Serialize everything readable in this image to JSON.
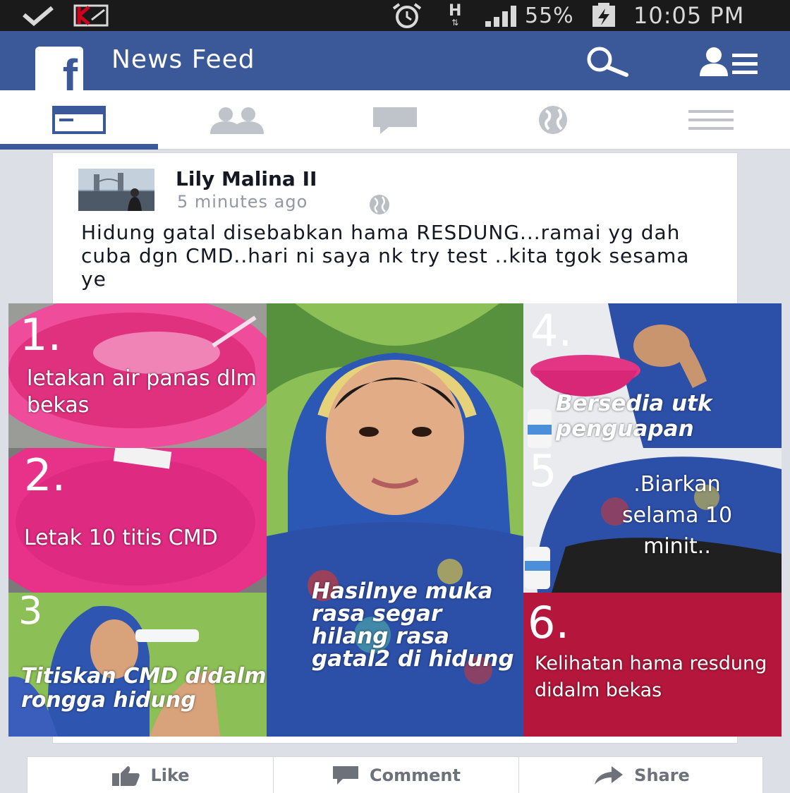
{
  "status_bar": {
    "battery": "55%",
    "time": "10:05 PM",
    "network_type": "H",
    "icons": [
      "check-icon",
      "kaspersky-icon",
      "alarm-icon",
      "network-h-icon",
      "signal-icon",
      "battery-charging-icon"
    ]
  },
  "header": {
    "logo": "f",
    "title": "News Feed",
    "icons": [
      "search-icon",
      "friend-requests-icon"
    ]
  },
  "tabs": [
    {
      "name": "news-feed",
      "icon": "news-feed-icon",
      "active": true
    },
    {
      "name": "friends",
      "icon": "friends-icon",
      "active": false
    },
    {
      "name": "messages",
      "icon": "messages-icon",
      "active": false
    },
    {
      "name": "notifications",
      "icon": "globe-icon",
      "active": false
    },
    {
      "name": "more",
      "icon": "menu-icon",
      "active": false
    }
  ],
  "post": {
    "author": "Lily Malina II",
    "timestamp": "5 minutes ago",
    "privacy_icon": "globe-icon",
    "text": "Hidung gatal disebabkan hama RESDUNG...ramai yg dah cuba dgn CMD..hari ni saya nk try test ..kita tgok sesama ye",
    "collage": {
      "step1": {
        "number": "1.",
        "caption": "letakan air panas dlm bekas"
      },
      "step2": {
        "number": "2.",
        "caption": "Letak 10 titis CMD"
      },
      "step3": {
        "number": "3",
        "caption": "Titiskan CMD didalm rongga hidung"
      },
      "center": {
        "caption": "Hasilnye muka rasa segar hilang rasa gatal2 di hidung"
      },
      "step4": {
        "number": "4.",
        "caption": "Bersedia utk penguapan"
      },
      "step5": {
        "number": "5",
        "caption": ".Biarkan selama 10 minit.."
      },
      "step6": {
        "number": "6.",
        "caption": "Kelihatan hama resdung didalm bekas"
      }
    }
  },
  "actions": {
    "like": "Like",
    "comment": "Comment",
    "share": "Share"
  },
  "colors": {
    "facebook_blue": "#3b5998",
    "status_bar": "#1a1a1a",
    "basin_pink": "#e0317f",
    "step6_red": "#b5163b"
  }
}
